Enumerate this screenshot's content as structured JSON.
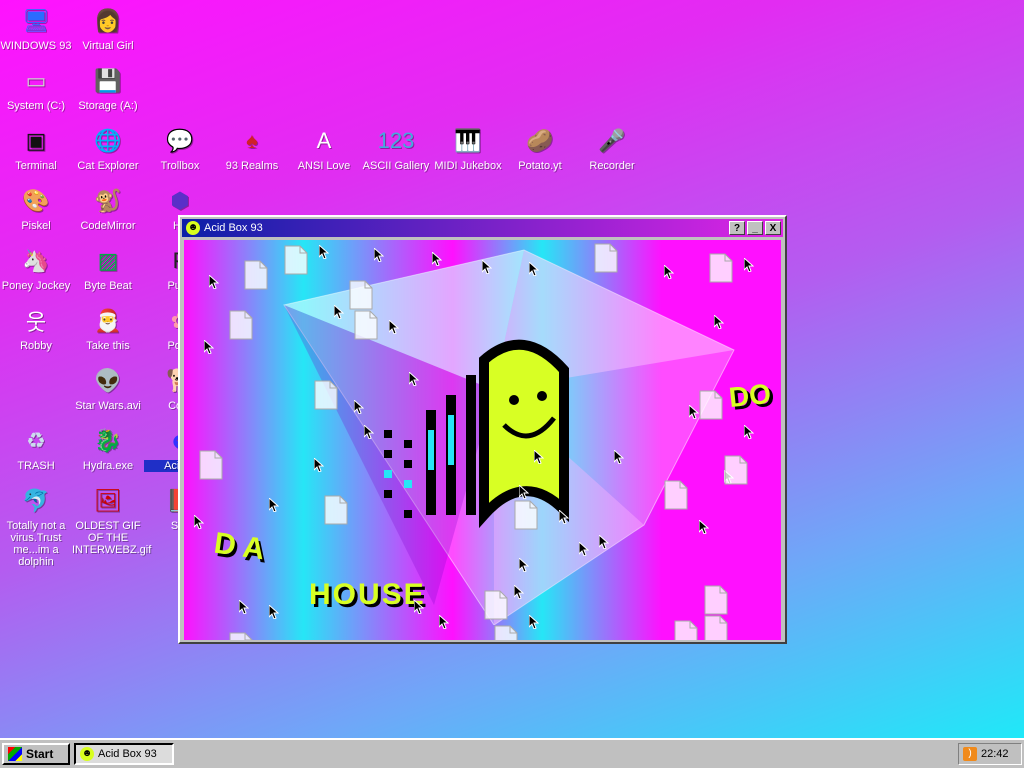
{
  "desktop": {
    "icons": [
      {
        "label": "WINDOWS 93",
        "icon": "computer-icon",
        "glyph": "🖥"
      },
      {
        "label": "Virtual Girl",
        "icon": "face-icon",
        "glyph": "👩"
      },
      {
        "label": "System (C:)",
        "icon": "drive-icon",
        "glyph": "▭"
      },
      {
        "label": "Storage (A:)",
        "icon": "floppy-icon",
        "glyph": "💾"
      },
      {
        "label": "Terminal",
        "icon": "terminal-icon",
        "glyph": "▣"
      },
      {
        "label": "Cat Explorer",
        "icon": "globe-icon",
        "glyph": "🌐"
      },
      {
        "label": "Trollbox",
        "icon": "chat-icon",
        "glyph": "💬"
      },
      {
        "label": "93 Realms",
        "icon": "realm-icon",
        "glyph": "♠"
      },
      {
        "label": "ANSI Love",
        "icon": "ansi-icon",
        "glyph": "A"
      },
      {
        "label": "ASCII Gallery",
        "icon": "ascii-icon",
        "glyph": "123"
      },
      {
        "label": "MIDI Jukebox",
        "icon": "piano-icon",
        "glyph": "🎹"
      },
      {
        "label": "Potato.yt",
        "icon": "potato-icon",
        "glyph": "🥔"
      },
      {
        "label": "Recorder",
        "icon": "microphone-icon",
        "glyph": "🎤"
      },
      {
        "label": "Piskel",
        "icon": "palette-icon",
        "glyph": "🎨"
      },
      {
        "label": "CodeMirror",
        "icon": "codemirror-icon",
        "glyph": "🐒"
      },
      {
        "label": "He",
        "icon": "hexagon-icon",
        "glyph": "⬢"
      },
      {
        "label": "Poney Jockey",
        "icon": "pony-icon",
        "glyph": "🦄"
      },
      {
        "label": "Byte Beat",
        "icon": "bytebeat-icon",
        "glyph": "▨"
      },
      {
        "label": "Puke",
        "icon": "puke-icon",
        "glyph": "P"
      },
      {
        "label": "Robby",
        "icon": "stickman-icon",
        "glyph": "웃"
      },
      {
        "label": "Take this",
        "icon": "santa-icon",
        "glyph": "🎅"
      },
      {
        "label": "Poké",
        "icon": "poke-icon",
        "glyph": "✿"
      },
      {
        "label": "Star Wars.avi",
        "icon": "yoda-icon",
        "glyph": "👽"
      },
      {
        "label": "Corg",
        "icon": "corgi-icon",
        "glyph": "🐕"
      },
      {
        "label": "TRASH",
        "icon": "trash-icon",
        "glyph": "♻"
      },
      {
        "label": "Hydra.exe",
        "icon": "hydra-icon",
        "glyph": "🐉"
      },
      {
        "label": "Acid B",
        "icon": "acidbox-icon",
        "glyph": "☻"
      },
      {
        "label": "Totally not a virus.Trust me...im a dolphin",
        "icon": "dolphin-icon",
        "glyph": "🐬"
      },
      {
        "label": "OLDEST GIF OF THE INTERWEBZ.gif",
        "icon": "gif-icon",
        "glyph": "🖼"
      },
      {
        "label": "SIN",
        "icon": "book-icon",
        "glyph": "📕"
      }
    ]
  },
  "window": {
    "title": "Acid Box 93",
    "buttons": [
      "?",
      "_",
      "X"
    ],
    "art_text": [
      "D A",
      "HOUSE",
      "DO"
    ]
  },
  "taskbar": {
    "start_label": "Start",
    "task_label": "Acid Box 93",
    "clock": "22:42"
  }
}
